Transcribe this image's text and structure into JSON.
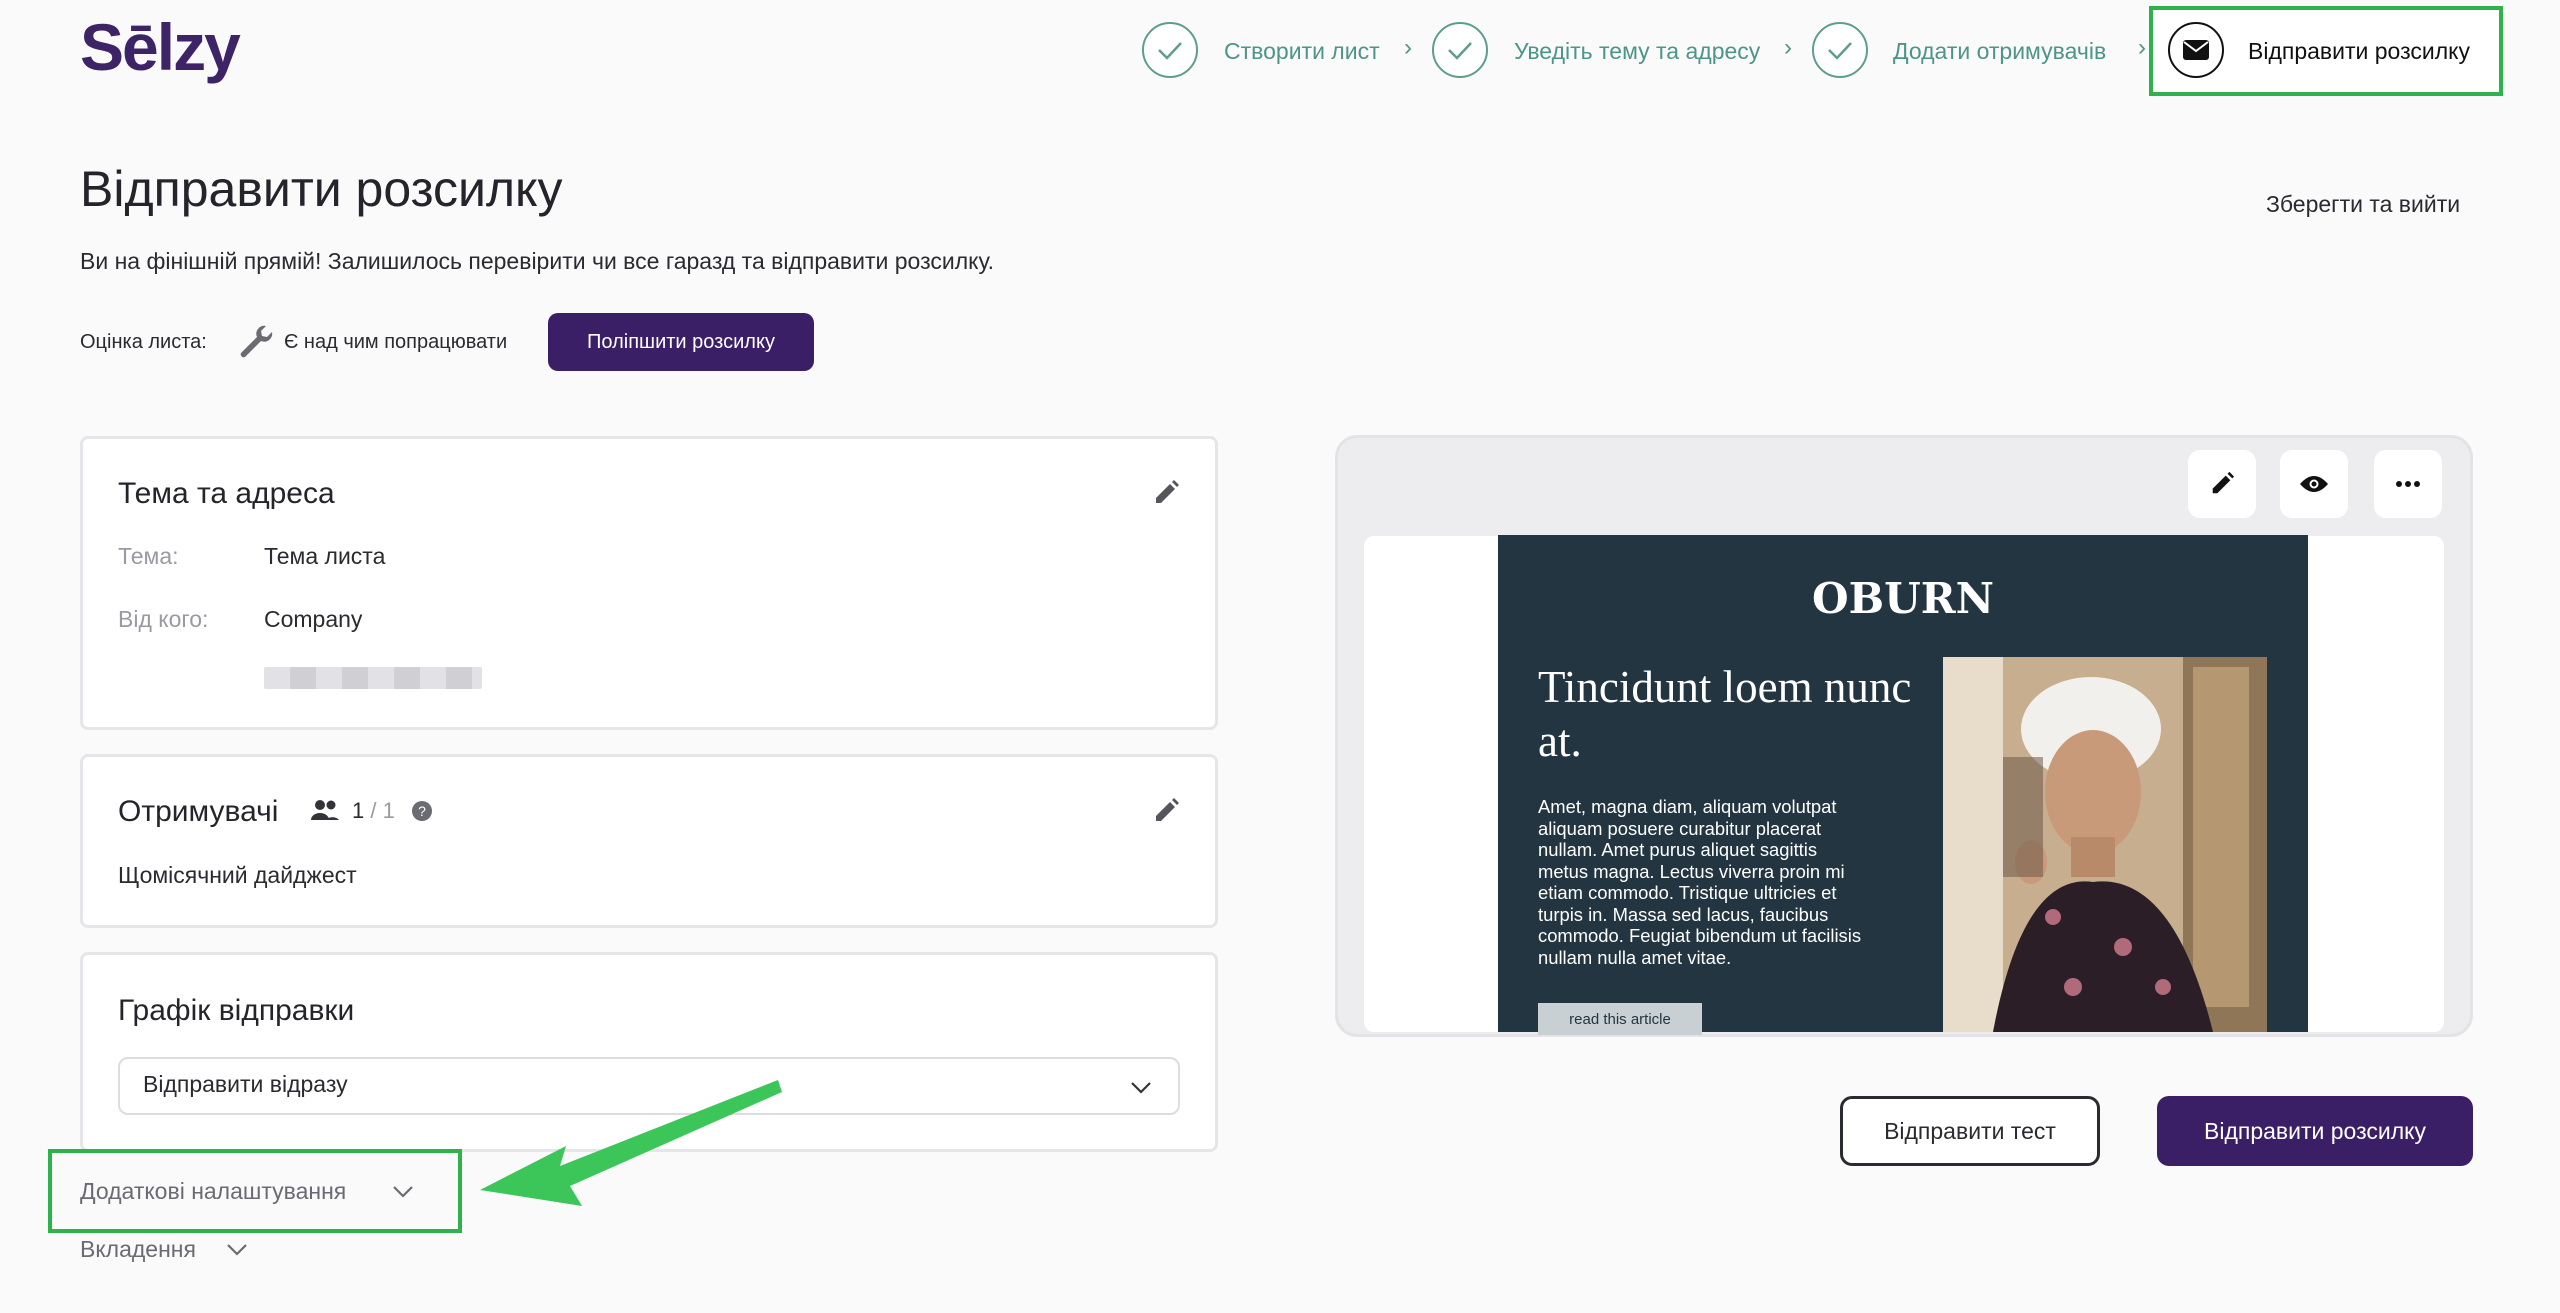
{
  "logo": {
    "text": "Sēlzy",
    "accent": "#3d2466"
  },
  "stepper": {
    "steps": [
      {
        "label": "Створити лист",
        "done": true
      },
      {
        "label": "Уведіть тему та адресу",
        "done": true
      },
      {
        "label": "Додати отримувачів",
        "done": true
      },
      {
        "label": "Відправити розсилку",
        "active": true
      }
    ],
    "separator": "›"
  },
  "header": {
    "title": "Відправити розсилку",
    "subtitle": "Ви на фінішній прямій! Залишилось перевірити чи все гаразд та відправити розсилку.",
    "save_exit": "Зберегти та вийти"
  },
  "rating": {
    "label": "Оцінка листа:",
    "value": "Є над чим попрацювати",
    "improve_button": "Поліпшити розсилку"
  },
  "subject_card": {
    "title": "Тема та адреса",
    "subject_label": "Тема:",
    "subject_value": "Тема листа",
    "from_label": "Від кого:",
    "from_value": "Company"
  },
  "recipients_card": {
    "title": "Отримувачі",
    "count": "1",
    "total": " / 1",
    "list_name": "Щомісячний дайджест"
  },
  "schedule_card": {
    "title": "Графік відправки",
    "selected": "Відправити відразу"
  },
  "extra": {
    "additional_settings": "Додаткові налаштування",
    "attachments": "Вкладення"
  },
  "preview": {
    "brand": "OBURN",
    "headline": "Tincidunt loem nunc at.",
    "body": "Amet, magna diam, aliquam volutpat aliquam posuere curabitur placerat nullam. Amet purus aliquet sagittis metus magna. Lectus viverra proin mi etiam commodo. Tristique ultricies et turpis in. Massa sed lacus, faucibus commodo. Feugiat bibendum ut facilisis nullam nulla amet vitae.",
    "cta": "read this article"
  },
  "actions": {
    "send_test": "Відправити тест",
    "send": "Відправити розсилку"
  },
  "colors": {
    "primary": "#3a1f66",
    "step_done": "#4d9588",
    "highlight": "#2fb14b"
  }
}
